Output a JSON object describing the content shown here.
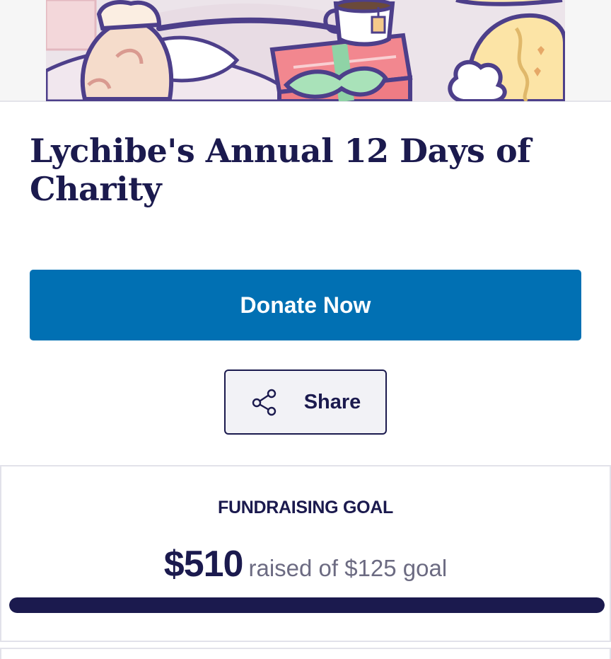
{
  "campaign": {
    "title": "Lychibe's Annual 12 Days of Charity"
  },
  "actions": {
    "donate_label": "Donate Now",
    "share_label": "Share"
  },
  "goal": {
    "label": "FUNDRAISING GOAL",
    "raised": "$510",
    "raised_suffix": "raised of $125 goal",
    "progress_fraction": 1.0
  },
  "icons": {
    "share": "share-icon"
  },
  "colors": {
    "primary_button": "#0170b3",
    "navy_text": "#1b1a4e",
    "muted_text": "#6c6b82"
  }
}
